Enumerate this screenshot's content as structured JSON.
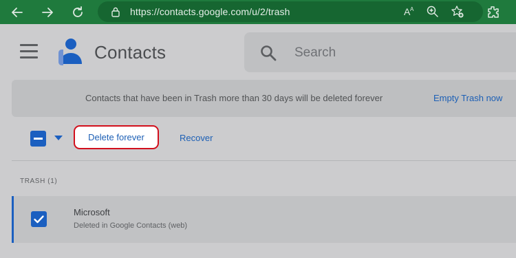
{
  "browser": {
    "url": "https://contacts.google.com/u/2/trash"
  },
  "header": {
    "title": "Contacts",
    "search_placeholder": "Search"
  },
  "notice": {
    "message": "Contacts that have been in Trash more than 30 days will be deleted forever",
    "action_label": "Empty Trash now"
  },
  "toolbar": {
    "delete_label": "Delete forever",
    "recover_label": "Recover"
  },
  "list": {
    "section_label": "TRASH (1)",
    "items": [
      {
        "name": "Microsoft",
        "subtitle": "Deleted in Google Contacts (web)",
        "selected": true
      }
    ]
  },
  "colors": {
    "accent": "#1b5fc0",
    "highlight": "#d20f1c",
    "browser_green": "#1f7a3d"
  }
}
